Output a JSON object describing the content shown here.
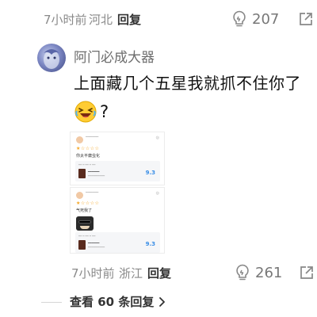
{
  "top_comment_meta": {
    "time": "7小时前",
    "location": "河北",
    "reply_label": "回复",
    "like_count": "207"
  },
  "comment": {
    "username": "阿门必成大器",
    "text": "上面藏几个五星我就抓不住你了",
    "emoji_suffix": "?"
  },
  "screenshot_1": {
    "stars": "★☆☆☆☆",
    "body": "你太平庸虫化",
    "score": "9.3"
  },
  "screenshot_2": {
    "stars": "★☆☆☆☆",
    "body": "气死我了",
    "score": "9.3"
  },
  "bottom_comment_meta": {
    "time": "7小时前",
    "location": "浙江",
    "reply_label": "回复",
    "like_count": "261"
  },
  "replies": {
    "label": "查看 60 条回复"
  },
  "icons": {
    "like": "lightbulb-icon",
    "share": "share-icon",
    "expand": "chevron-right-icon",
    "emoji": "laughing-emoji-icon"
  },
  "colors": {
    "meta_gray": "#8a8a8a",
    "username_gray": "#6d6d6d",
    "text_dark": "#111111",
    "score_blue": "#3a8ee6",
    "star_orange": "#f5a623"
  }
}
